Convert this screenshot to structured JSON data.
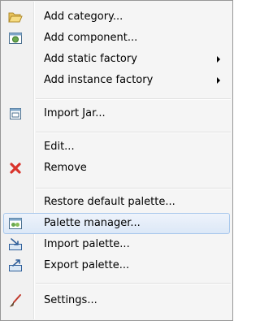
{
  "menu": {
    "items": [
      {
        "label": "Add category...",
        "icon": "folder-open-icon"
      },
      {
        "label": "Add component...",
        "icon": "component-icon"
      },
      {
        "label": "Add static factory",
        "submenu": true
      },
      {
        "label": "Add instance factory",
        "submenu": true
      },
      {
        "label": "Import Jar...",
        "icon": "jar-icon"
      },
      {
        "label": "Edit..."
      },
      {
        "label": "Remove",
        "icon": "remove-icon"
      },
      {
        "label": "Restore default palette..."
      },
      {
        "label": "Palette manager...",
        "icon": "palette-manager-icon",
        "highlighted": true
      },
      {
        "label": "Import palette...",
        "icon": "import-icon"
      },
      {
        "label": "Export palette...",
        "icon": "export-icon"
      },
      {
        "label": "Settings...",
        "icon": "settings-brush-icon"
      }
    ]
  }
}
